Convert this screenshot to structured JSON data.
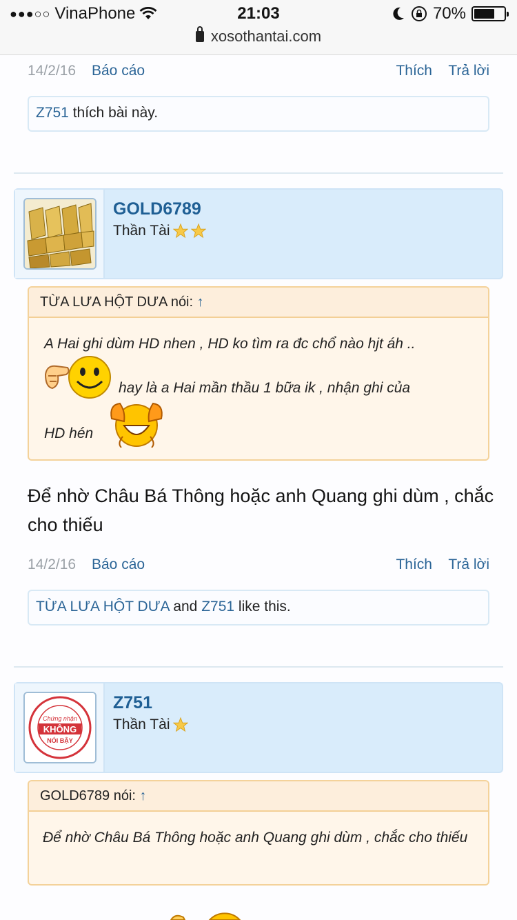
{
  "status_bar": {
    "signal_dots": "●●●○○",
    "carrier": "VinaPhone",
    "time": "21:03",
    "battery": "70%",
    "battery_fraction": 0.7,
    "url": "xosothantai.com"
  },
  "post1_footer": {
    "date": "14/2/16",
    "report": "Báo cáo",
    "like": "Thích",
    "reply": "Trả lời",
    "likes_user": "Z751",
    "likes_text": " thích bài này."
  },
  "post2": {
    "username": "GOLD6789",
    "user_title": "Thần Tài",
    "quote_author": "TỪA LƯA HỘT DƯA nói: ",
    "quote_arrow": "↑",
    "quote_line1": "A Hai ghi dùm HD nhen , HD ko tìm ra đc chổ nào hjt áh ..",
    "quote_line2": "hay là a Hai mần thầu 1 bữa ik , nhận ghi của",
    "quote_line3": "HD hén",
    "message": "Để nhờ Châu Bá Thông hoặc anh Quang ghi dùm , chắc cho thiếu",
    "date": "14/2/16",
    "report": "Báo cáo",
    "like": "Thích",
    "reply": "Trả lời",
    "likes_user1": "TỪA LƯA HỘT DƯA",
    "likes_and": " and ",
    "likes_user2": "Z751",
    "likes_suffix": " like this."
  },
  "post3": {
    "username": "Z751",
    "user_title": "Thần Tài",
    "avatar_badge": "KHÔNG",
    "avatar_top": "Chứng nhận",
    "avatar_bottom": "NÓI BẬY",
    "quote_author": "GOLD6789 nói: ",
    "quote_arrow": "↑",
    "quote_text": "Để nhờ Châu Bá Thông hoặc anh Quang ghi dùm , chắc cho thiếu"
  }
}
